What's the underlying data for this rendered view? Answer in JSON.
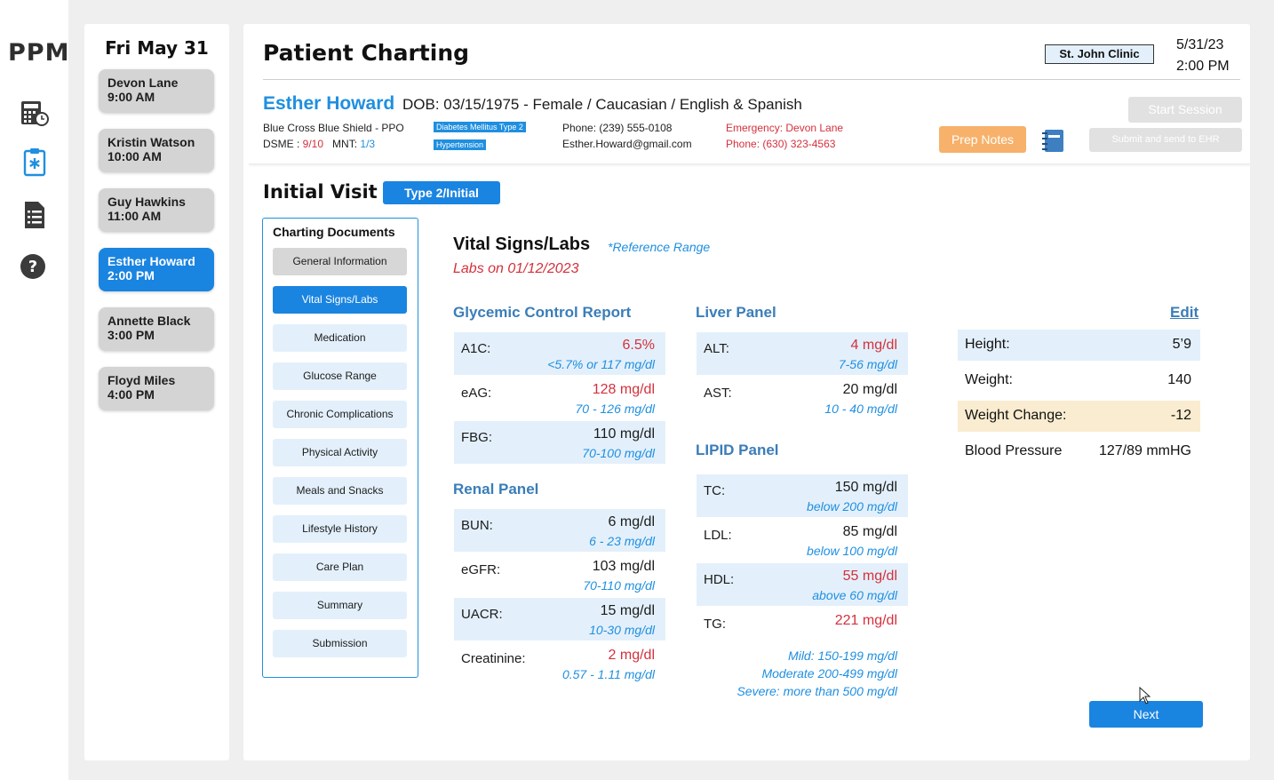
{
  "app": {
    "logo": "PPM"
  },
  "rail_icons": [
    "calculator-clock-icon",
    "clipboard-medical-icon",
    "document-list-icon",
    "help-icon"
  ],
  "schedule": {
    "date": "Fri May 31",
    "appointments": [
      {
        "name": "Devon Lane",
        "time": "9:00 AM"
      },
      {
        "name": "Kristin Watson",
        "time": "10:00 AM"
      },
      {
        "name": "Guy Hawkins",
        "time": "11:00 AM"
      },
      {
        "name": "Esther Howard",
        "time": "2:00 PM"
      },
      {
        "name": "Annette Black",
        "time": "3:00 PM"
      },
      {
        "name": "Floyd Miles",
        "time": "4:00 PM"
      }
    ]
  },
  "header": {
    "title": "Patient Charting",
    "clinic": "St. John Clinic",
    "date": "5/31/23",
    "time": "2:00 PM"
  },
  "patient": {
    "name": "Esther Howard",
    "demographics": "DOB: 03/15/1975  -  Female / Caucasian / English & Spanish",
    "insurance": "Blue Cross Blue Shield - PPO",
    "dsme_label": "DSME : ",
    "dsme_value": "9/10",
    "mnt_label": "MNT: ",
    "mnt_value": "1/3",
    "tag_diabetes": "Diabetes Mellitus Type 2",
    "tag_hypertension": "Hypertension",
    "phone": "Phone: (239) 555-0108",
    "email": "Esther.Howard@gmail.com",
    "emergency": "Emergency: Devon Lane",
    "emergency_phone": "Phone: (630) 323-4563"
  },
  "actions": {
    "prep_notes": "Prep Notes",
    "start_session": "Start Session",
    "submit": "Submit and send to EHR",
    "next": "Next",
    "edit": "Edit"
  },
  "visit": {
    "title": "Initial Visit",
    "type": "Type 2/Initial"
  },
  "docs": {
    "title": "Charting Documents",
    "items": [
      "General Information",
      "Vital Signs/Labs",
      "Medication",
      "Glucose Range",
      "Chronic Complications",
      "Physical Activity",
      "Meals and Snacks",
      "Lifestyle History",
      "Care Plan",
      "Summary",
      "Submission"
    ],
    "active_index": 1
  },
  "vitals": {
    "title": "Vital Signs/Labs",
    "reference": "*Reference Range",
    "labs_date": "Labs on 01/12/2023",
    "glycemic_title": "Glycemic Control Report",
    "glycemic": [
      {
        "label": "A1C:",
        "value": "6.5%",
        "range": "<5.7% or 117 mg/dl",
        "flag": "red"
      },
      {
        "label": "eAG:",
        "value": "128 mg/dl",
        "range": "70 - 126 mg/dl",
        "flag": "red"
      },
      {
        "label": "FBG:",
        "value": "110 mg/dl",
        "range": "70-100 mg/dl",
        "flag": "normal"
      }
    ],
    "renal_title": "Renal Panel",
    "renal": [
      {
        "label": "BUN:",
        "value": "6 mg/dl",
        "range": "6 - 23 mg/dl",
        "flag": "normal"
      },
      {
        "label": "eGFR:",
        "value": "103 mg/dl",
        "range": "70-110 mg/dl",
        "flag": "normal"
      },
      {
        "label": "UACR:",
        "value": "15 mg/dl",
        "range": "10-30 mg/dl",
        "flag": "normal"
      },
      {
        "label": "Creatinine:",
        "value": "2 mg/dl",
        "range": "0.57 - 1.11 mg/dl",
        "flag": "red"
      }
    ],
    "liver_title": "Liver Panel",
    "liver": [
      {
        "label": "ALT:",
        "value": "4 mg/dl",
        "range": "7-56 mg/dl",
        "flag": "red"
      },
      {
        "label": "AST:",
        "value": "20 mg/dl",
        "range": "10 - 40 mg/dl",
        "flag": "normal"
      }
    ],
    "lipid_title": "LIPID Panel",
    "lipid": [
      {
        "label": "TC:",
        "value": "150 mg/dl",
        "range": "below 200 mg/dl",
        "flag": "normal"
      },
      {
        "label": "LDL:",
        "value": "85 mg/dl",
        "range": "below 100 mg/dl",
        "flag": "normal"
      },
      {
        "label": "HDL:",
        "value": "55 mg/dl",
        "range": "above 60 mg/dl",
        "flag": "red"
      },
      {
        "label": "TG:",
        "value": "221 mg/dl",
        "flag": "red"
      }
    ],
    "tg_ranges": [
      "Mild: 150-199 mg/dl",
      "Moderate 200-499 mg/dl",
      "Severe: more than 500 mg/dl"
    ],
    "measurements": [
      {
        "label": "Height:",
        "value": "5’9"
      },
      {
        "label": "Weight:",
        "value": "140"
      },
      {
        "label": "Weight Change:",
        "value": "-12"
      },
      {
        "label": "Blood Pressure",
        "value": "127/89 mmHG"
      }
    ]
  },
  "colors": {
    "accent": "#1a84e1",
    "alert": "#d4303c",
    "prep": "#f7b16a",
    "shade": "#e3f0fb",
    "warm": "#faecd0"
  }
}
